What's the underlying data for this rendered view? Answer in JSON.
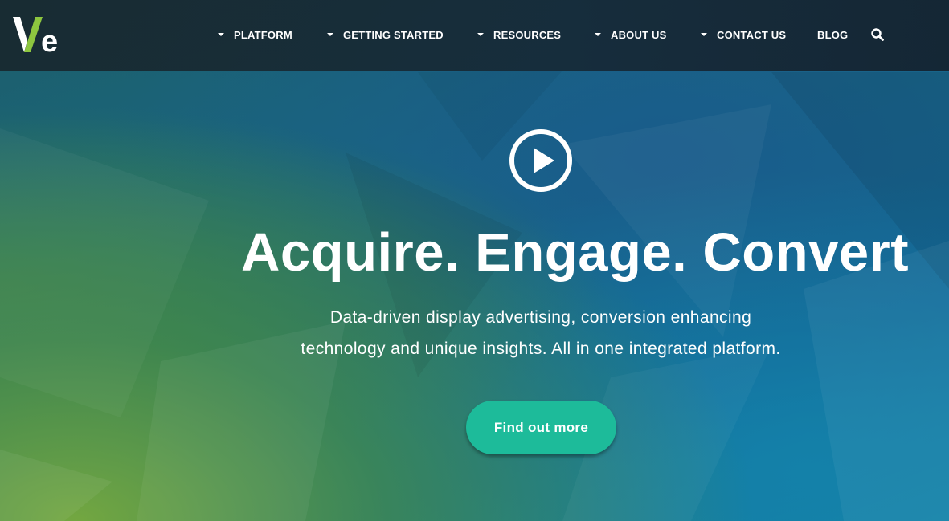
{
  "brand": {
    "logo_text": "Ve",
    "colors": {
      "logo_v": "#8dc63f",
      "logo_e": "#ffffff",
      "cta": "#1dbb9a",
      "nav_bg": "#18282e"
    }
  },
  "nav": {
    "items": [
      {
        "label": "PLATFORM",
        "has_dropdown": true,
        "icon": "caret-down-icon"
      },
      {
        "label": "GETTING STARTED",
        "has_dropdown": true,
        "icon": "caret-down-icon"
      },
      {
        "label": "RESOURCES",
        "has_dropdown": true,
        "icon": "caret-down-icon"
      },
      {
        "label": "ABOUT US",
        "has_dropdown": true,
        "icon": "caret-down-icon"
      },
      {
        "label": "CONTACT US",
        "has_dropdown": true,
        "icon": "caret-down-icon"
      },
      {
        "label": "BLOG",
        "has_dropdown": false
      }
    ],
    "search_icon": "search-icon"
  },
  "hero": {
    "play_icon": "play-icon",
    "headline": "Acquire. Engage. Convert",
    "subtitle_line1": "Data-driven display advertising, conversion enhancing",
    "subtitle_line2": "technology and unique insights. All in one integrated platform.",
    "cta_label": "Find out more"
  }
}
